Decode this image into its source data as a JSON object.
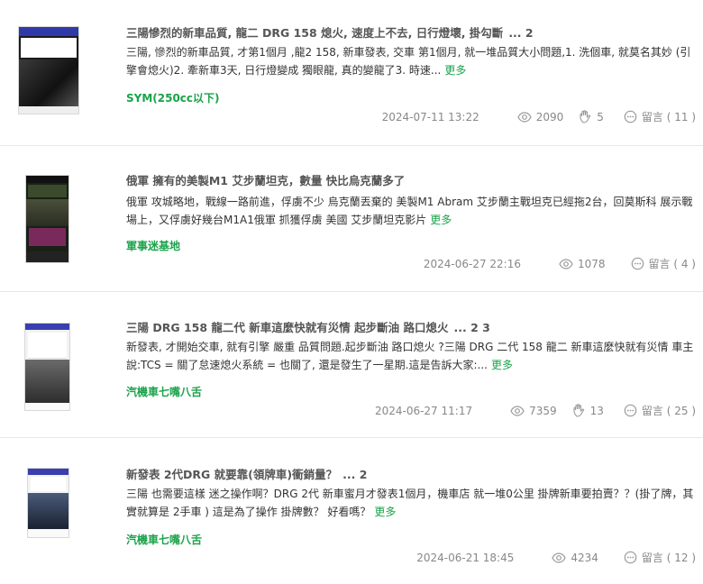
{
  "posts": [
    {
      "title": "三陽慘烈的新車品質, 龍二 DRG 158 熄火, 速度上不去, 日行燈壞, 掛勾斷",
      "pages": "... 2",
      "excerpt": "三陽, 慘烈的新車品質, 才第1個月 ,龍2 158, 新車發表, 交車 第1個月, 就一堆品質大小問題,1. 洗個車, 就莫名其妙 (引擎會熄火)2. 牽新車3天, 日行燈變成 獨眼龍, 真的變龍了3. 時速...",
      "more": "更多",
      "forum": "SYM(250cc以下)",
      "date": "2024-07-11 13:22",
      "views": "2090",
      "likes": "5",
      "comments": "留言 ( 11 )"
    },
    {
      "title": "俄軍 擁有的美製M1 艾步蘭坦克，數量 快比烏克蘭多了",
      "pages": "",
      "excerpt": "俄軍 攻城略地，戰線一路前進，俘虜不少 烏克蘭丟棄的 美製M1 Abram 艾步蘭主戰坦克已經拖2台，回莫斯科 展示戰場上，又俘虜好幾台M1A1俄軍 抓獲俘虜 美國 艾步蘭坦克影片",
      "more": "更多",
      "forum": "軍事迷基地",
      "date": "2024-06-27 22:16",
      "views": "1078",
      "likes": "",
      "comments": "留言 ( 4 )"
    },
    {
      "title": "三陽 DRG 158 龍二代 新車這麼快就有災情 起步斷油 路口熄火",
      "pages": "... 2 3",
      "excerpt": "新發表, 才開始交車, 就有引擎 嚴重 品質問題.起步斷油 路口熄火 ?三陽 DRG 二代 158 龍二 新車這麼快就有災情 車主說:TCS = 關了怠速熄火系統 = 也關了, 還是發生了一星期.這是告訴大家:...",
      "more": "更多",
      "forum": "汽機車七嘴八舌",
      "date": "2024-06-27 11:17",
      "views": "7359",
      "likes": "13",
      "comments": "留言 ( 25 )"
    },
    {
      "title": "新發表 2代DRG 就要靠(領牌車)衝銷量？",
      "pages": "... 2",
      "excerpt": "三陽 也需要這樣 迷之操作啊？DRG 2代 新車蜜月才發表1個月，機車店 就一堆0公里 掛牌新車要拍賣？？(掛了牌，其實就算是 2手車 ) 這是為了操作 掛牌數？ 好看嗎？",
      "more": "更多",
      "forum": "汽機車七嘴八舌",
      "date": "2024-06-21 18:45",
      "views": "4234",
      "likes": "",
      "comments": "留言 ( 12 )"
    }
  ],
  "icons": {
    "views": "eye-icon",
    "likes": "clap-hand-icon",
    "comments": "comment-bubble-icon"
  },
  "colors": {
    "accent_green": "#1aa34a",
    "meta_gray": "#888888",
    "divider": "#e6e6e6"
  }
}
